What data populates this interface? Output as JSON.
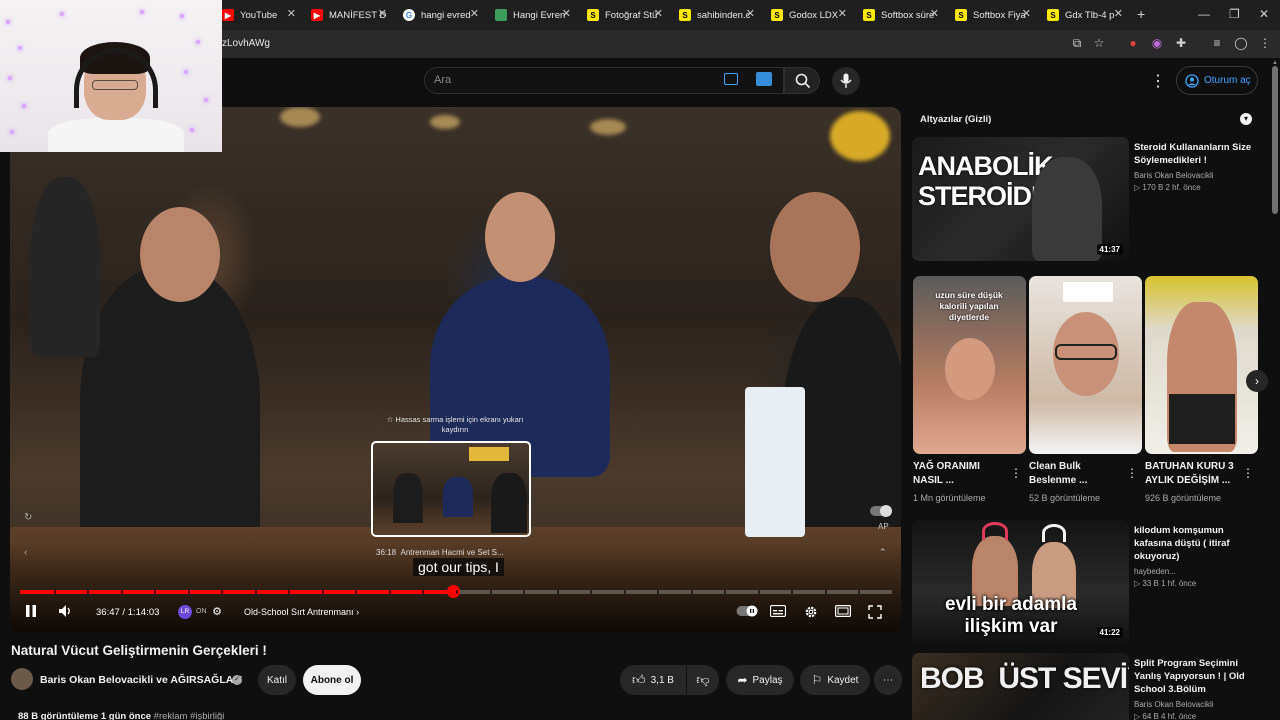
{
  "browser": {
    "tabs": [
      {
        "label": "YouTube",
        "favicon": "youtube-icon",
        "color": "#ff0000"
      },
      {
        "label": "MANİFEST D",
        "favicon": "youtube-icon",
        "color": "#ff0000"
      },
      {
        "label": "hangi evred",
        "favicon": "google-icon",
        "color": "#ffffff"
      },
      {
        "label": "Hangi Evren",
        "favicon": "site-icon",
        "color": "#3d9b5c"
      },
      {
        "label": "Fotoğraf Stü",
        "favicon": "sahibinden-icon",
        "color": "#ffe800"
      },
      {
        "label": "sahibinden.c",
        "favicon": "sahibinden-icon",
        "color": "#ffe800"
      },
      {
        "label": "Godox LDX",
        "favicon": "sahibinden-icon",
        "color": "#ffe800"
      },
      {
        "label": "Softbox süre",
        "favicon": "sahibinden-icon",
        "color": "#ffe800"
      },
      {
        "label": "Softbox Fiya",
        "favicon": "sahibinden-icon",
        "color": "#ffe800"
      },
      {
        "label": "Gdx Tlb-4 p",
        "favicon": "sahibinden-icon",
        "color": "#ffe800"
      }
    ],
    "url_fragment": "zLovhAWg"
  },
  "header": {
    "search_placeholder": "Ara",
    "signin_label": "Oturum aç"
  },
  "player": {
    "subtitle_text": "got our tips, I",
    "preview_hint": "Hassas sarma işlemi için ekranı yukarı kaydırın",
    "preview_time": "36:18",
    "preview_chapter": "Antrenman Hacmi ve Set S...",
    "time_display": "36:47 / 1:14:03",
    "lr_badge": "LR",
    "lr_state": "ON",
    "chapter_label": "Old-School Sırt Antrenmanı",
    "autoplay_label": "AP",
    "progress_fraction": 0.497,
    "accent_color": "#ff0000"
  },
  "video": {
    "title": "Natural Vücut Geliştirmenin Gerçekleri !",
    "channel": "Baris Okan Belovacikli ve AĞIRSAĞLAM",
    "join_label": "Katıl",
    "subscribe_label": "Abone ol",
    "likes": "3,1 B",
    "share_label": "Paylaş",
    "save_label": "Kaydet",
    "views_line": "88 B görüntüleme  1 gün önce",
    "tags_line": "#reklam #işbirliği"
  },
  "sidebar": {
    "subtitles_header": "Altyazılar (Gizli)",
    "recommendations": [
      {
        "title": "Steroid Kullananların Size Söylemedikleri !",
        "channel": "Baris Okan Belovacikli",
        "info": "170 B  2 hf. önce",
        "duration": "41:37",
        "thumb_text": "ANABOLİK STEROİDLER"
      },
      {
        "title": "kilodum komşumun kafasına düştü ( itiraf okuyoruz)",
        "channel": "haybeden...",
        "info": "33 B  1 hf. önce",
        "duration": "41:22",
        "thumb_text": "evli bir adamla ilişkim var"
      },
      {
        "title": "Split Program Seçimini Yanlış Yapıyorsun ! | Old School 3.Bölüm",
        "channel": "Baris Okan Belovacikli",
        "info": "64 B  4 hf. önce",
        "duration": "",
        "thumb_text": "BOB  ÜST SEVİYEYE"
      }
    ],
    "shorts": [
      {
        "title": "YAĞ ORANIMI NASIL ...",
        "views": "1 Mn görüntüleme",
        "overlay": "uzun süre düşük kalorili yapılan diyetlerde"
      },
      {
        "title": "Clean Bulk Beslenme ...",
        "views": "52 B görüntüleme",
        "overlay": ""
      },
      {
        "title": "BATUHAN KURU 3 AYLIK DEĞİŞİM ...",
        "views": "926 B görüntüleme",
        "overlay": ""
      }
    ]
  }
}
